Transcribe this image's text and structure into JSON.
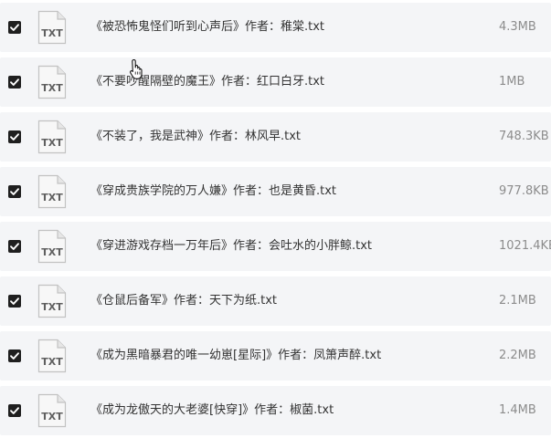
{
  "icon_label": "TXT",
  "files": [
    {
      "name": "《被恐怖鬼怪们听到心声后》作者：稚棠.txt",
      "size": "4.3MB",
      "checked": true
    },
    {
      "name": "《不要吵醒隔壁的魔王》作者：红口白牙.txt",
      "size": "1MB",
      "checked": true
    },
    {
      "name": "《不装了，我是武神》作者：林风早.txt",
      "size": "748.3KB",
      "checked": true
    },
    {
      "name": "《穿成贵族学院的万人嫌》作者：也是黄昏.txt",
      "size": "977.8KB",
      "checked": true
    },
    {
      "name": "《穿进游戏存档一万年后》作者：会吐水的小胖鲸.txt",
      "size": "1021.4KB",
      "checked": true
    },
    {
      "name": "《仓鼠后备军》作者：天下为纸.txt",
      "size": "2.1MB",
      "checked": true
    },
    {
      "name": "《成为黑暗暴君的唯一幼崽[星际]》作者：凤箫声醉.txt",
      "size": "2.2MB",
      "checked": true
    },
    {
      "name": "《成为龙傲天的大老婆[快穿]》作者：椒菌.txt",
      "size": "1.4MB",
      "checked": true
    }
  ],
  "icons": {
    "checkbox": "checkbox-checked-icon",
    "file": "txt-file-icon",
    "cursor": "hand-pointer-cursor-icon"
  },
  "colors": {
    "row_background": "#f4f5f7",
    "checkbox_fill": "#1f1f1f",
    "name_text": "#333333",
    "size_text": "#8c8c8c"
  }
}
